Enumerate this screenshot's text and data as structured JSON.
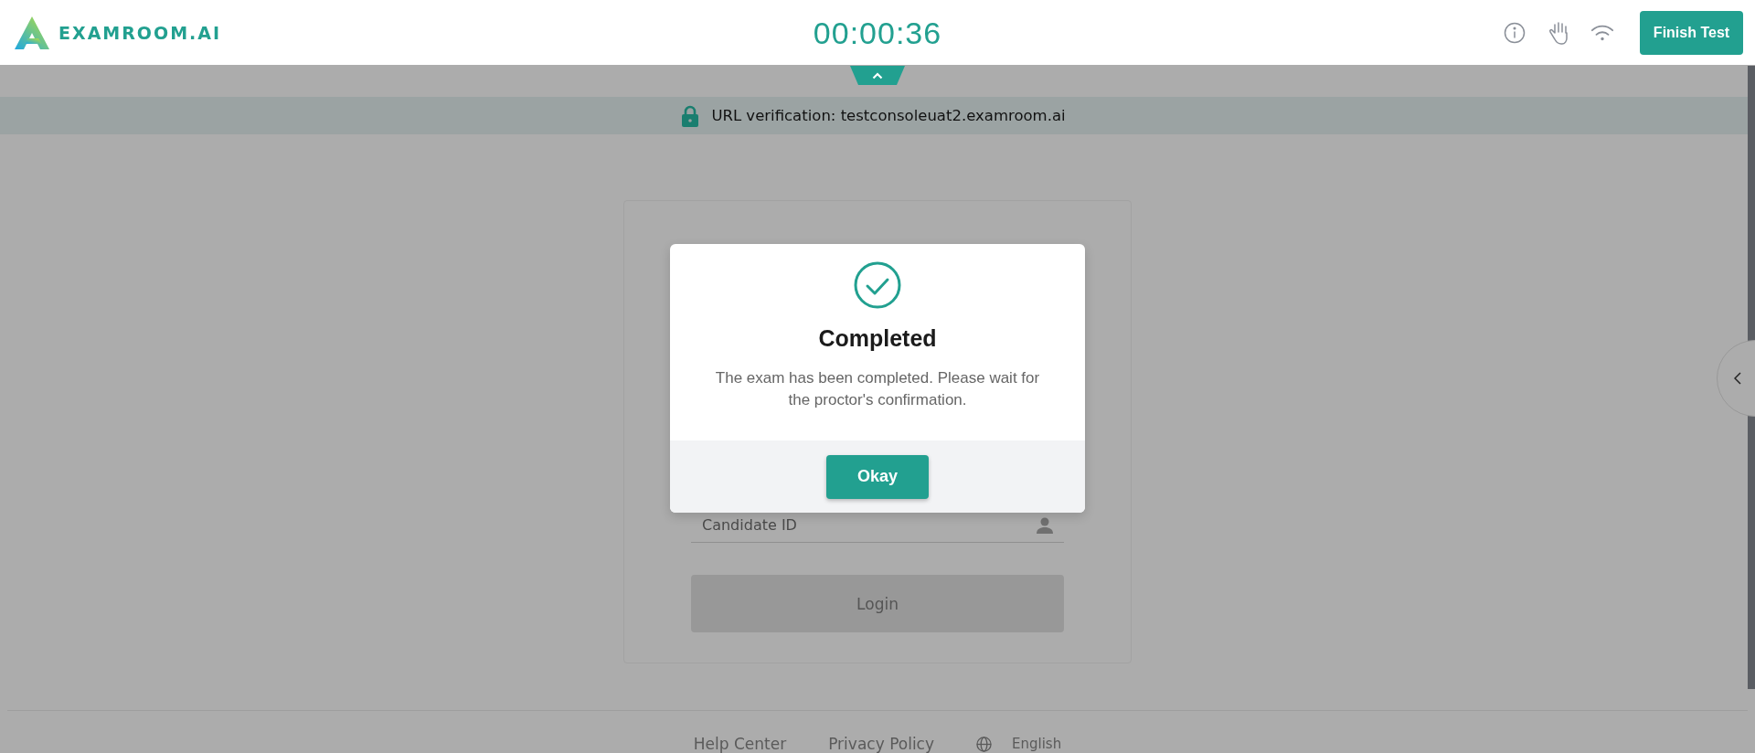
{
  "header": {
    "logo": "EXAMROOM.AI",
    "timer": "00:00:36",
    "finish_button": "Finish Test"
  },
  "url_bar": {
    "text": "URL verification: testconsoleuat2.examroom.ai"
  },
  "login_form": {
    "candidate_id": {
      "placeholder": "Candidate ID"
    },
    "login_button": {
      "label": "Login",
      "disabled": true
    }
  },
  "footer": {
    "links": [
      "Help Center",
      "Privacy Policy"
    ],
    "language": "English"
  },
  "dialog": {
    "title": "Completed",
    "message": "The exam has been completed. Please wait for the proctor's confirmation.",
    "button": "Okay"
  }
}
